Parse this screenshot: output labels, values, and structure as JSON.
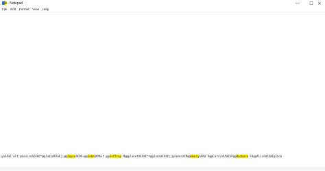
{
  "window": {
    "title_highlight": "b",
    "title": "- Notepad",
    "controls": {
      "minimize": "—",
      "maximize": "☐",
      "close": "✕"
    }
  },
  "menu": [
    "File",
    "Edit",
    "Format",
    "View",
    "Help"
  ],
  "editor": {
    "line_segments": [
      {
        "text": "yâ€Ãâ€˜&lt;@Louiseâ€Ãâ€™@@Judyâ€Ãâ€¦¦@@",
        "highlight": false
      },
      {
        "text": "Joyce",
        "highlight": true
      },
      {
        "text": "â€Ð€¤@@",
        "highlight": false
      },
      {
        "text": "John",
        "highlight": true
      },
      {
        "text": "â€M&lt;@@",
        "highlight": false
      },
      {
        "text": "Jeffrey",
        "highlight": true
      },
      {
        "text": " M@@planetâ€Ãâ€™ª@@Janaâ€Ãâ€¦¦@Jamesâ€M@@",
        "highlight": false
      },
      {
        "text": "Henry",
        "highlight": true
      },
      {
        "text": "â€MâˆÂ@@Carolâ€Ãâ€SP@@",
        "highlight": false
      },
      {
        "text": "Barbara",
        "highlight": true
      },
      {
        "text": " Fd@@Aliceâ€Ãâ€@Jack",
        "highlight": false
      }
    ]
  },
  "colors": {
    "highlight": "#fff200",
    "background": "#ffffff"
  }
}
